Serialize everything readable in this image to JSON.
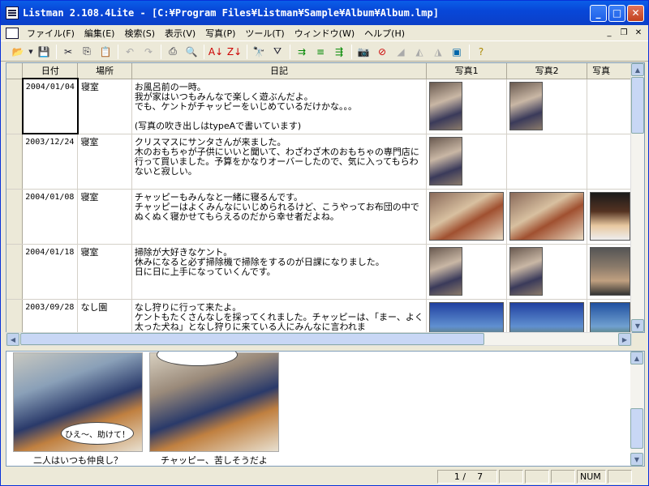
{
  "window": {
    "title": "Listman 2.108.4Lite - [C:¥Program Files¥Listman¥Sample¥Album¥Album.lmp]"
  },
  "menu": [
    "ファイル(F)",
    "編集(E)",
    "検索(S)",
    "表示(V)",
    "写真(P)",
    "ツール(T)",
    "ウィンドウ(W)",
    "ヘルプ(H)"
  ],
  "columns": {
    "date": "日付",
    "place": "場所",
    "diary": "日記",
    "photo1": "写真1",
    "photo2": "写真2",
    "photo3": "写真"
  },
  "rows": [
    {
      "date": "2004/01/04",
      "place": "寝室",
      "diary": "お風呂前の一時。\n我が家はいつもみんなで楽しく遊ぶんだよ。\nでも、ケントがチャッピーをいじめているだけかな。。。\n\n(写真の吹き出しはtypeAで書いています)"
    },
    {
      "date": "2003/12/24",
      "place": "寝室",
      "diary": "クリスマスにサンタさんが来ました。\n木のおもちゃが子供にいいと聞いて、わざわざ木のおもちゃの専門店に行って買いました。予算をかなりオーバーしたので、気に入ってもらわないと寂しい。"
    },
    {
      "date": "2004/01/08",
      "place": "寝室",
      "diary": "チャッピーもみんなと一緒に寝るんです。\nチャッピーはよくみんなにいじめられるけど、こうやってお布団の中でぬくぬく寝かせてもらえるのだから幸せ者だよね。"
    },
    {
      "date": "2004/01/18",
      "place": "寝室",
      "diary": "掃除が大好きなケント。\n休みになると必ず掃除機で掃除をするのが日課になりました。\n日に日に上手になっていくんです。"
    },
    {
      "date": "2003/09/28",
      "place": "なし園",
      "diary": "なし狩りに行って来たよ。\nケントもたくさんなしを採ってくれました。チャッピーは、「まー、よく太った犬ね」となし狩りに来ている人にみんなに言われま"
    }
  ],
  "preview": {
    "captions": [
      "二人はいつも仲良し？",
      "チャッピー、苦しそうだよ"
    ],
    "bubble": "ひえ～、助けて！"
  },
  "status": {
    "page": "1 /",
    "total": "7",
    "num": "NUM"
  },
  "icons": [
    "open-icon",
    "save-icon",
    "cut-icon",
    "copy-icon",
    "paste-icon",
    "undo-icon",
    "redo-icon",
    "print-icon",
    "preview-icon",
    "sort-asc-icon",
    "sort-desc-icon",
    "find-icon",
    "filter-icon",
    "camera-icon",
    "help-icon"
  ]
}
